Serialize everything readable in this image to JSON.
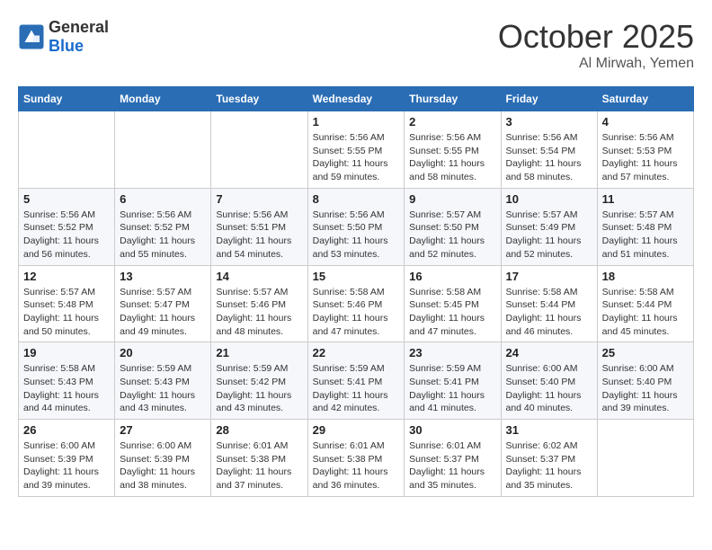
{
  "header": {
    "logo_general": "General",
    "logo_blue": "Blue",
    "month": "October 2025",
    "location": "Al Mirwah, Yemen"
  },
  "days_of_week": [
    "Sunday",
    "Monday",
    "Tuesday",
    "Wednesday",
    "Thursday",
    "Friday",
    "Saturday"
  ],
  "weeks": [
    [
      {
        "day": "",
        "sunrise": "",
        "sunset": "",
        "daylight": ""
      },
      {
        "day": "",
        "sunrise": "",
        "sunset": "",
        "daylight": ""
      },
      {
        "day": "",
        "sunrise": "",
        "sunset": "",
        "daylight": ""
      },
      {
        "day": "1",
        "sunrise": "Sunrise: 5:56 AM",
        "sunset": "Sunset: 5:55 PM",
        "daylight": "Daylight: 11 hours and 59 minutes."
      },
      {
        "day": "2",
        "sunrise": "Sunrise: 5:56 AM",
        "sunset": "Sunset: 5:55 PM",
        "daylight": "Daylight: 11 hours and 58 minutes."
      },
      {
        "day": "3",
        "sunrise": "Sunrise: 5:56 AM",
        "sunset": "Sunset: 5:54 PM",
        "daylight": "Daylight: 11 hours and 58 minutes."
      },
      {
        "day": "4",
        "sunrise": "Sunrise: 5:56 AM",
        "sunset": "Sunset: 5:53 PM",
        "daylight": "Daylight: 11 hours and 57 minutes."
      }
    ],
    [
      {
        "day": "5",
        "sunrise": "Sunrise: 5:56 AM",
        "sunset": "Sunset: 5:52 PM",
        "daylight": "Daylight: 11 hours and 56 minutes."
      },
      {
        "day": "6",
        "sunrise": "Sunrise: 5:56 AM",
        "sunset": "Sunset: 5:52 PM",
        "daylight": "Daylight: 11 hours and 55 minutes."
      },
      {
        "day": "7",
        "sunrise": "Sunrise: 5:56 AM",
        "sunset": "Sunset: 5:51 PM",
        "daylight": "Daylight: 11 hours and 54 minutes."
      },
      {
        "day": "8",
        "sunrise": "Sunrise: 5:56 AM",
        "sunset": "Sunset: 5:50 PM",
        "daylight": "Daylight: 11 hours and 53 minutes."
      },
      {
        "day": "9",
        "sunrise": "Sunrise: 5:57 AM",
        "sunset": "Sunset: 5:50 PM",
        "daylight": "Daylight: 11 hours and 52 minutes."
      },
      {
        "day": "10",
        "sunrise": "Sunrise: 5:57 AM",
        "sunset": "Sunset: 5:49 PM",
        "daylight": "Daylight: 11 hours and 52 minutes."
      },
      {
        "day": "11",
        "sunrise": "Sunrise: 5:57 AM",
        "sunset": "Sunset: 5:48 PM",
        "daylight": "Daylight: 11 hours and 51 minutes."
      }
    ],
    [
      {
        "day": "12",
        "sunrise": "Sunrise: 5:57 AM",
        "sunset": "Sunset: 5:48 PM",
        "daylight": "Daylight: 11 hours and 50 minutes."
      },
      {
        "day": "13",
        "sunrise": "Sunrise: 5:57 AM",
        "sunset": "Sunset: 5:47 PM",
        "daylight": "Daylight: 11 hours and 49 minutes."
      },
      {
        "day": "14",
        "sunrise": "Sunrise: 5:57 AM",
        "sunset": "Sunset: 5:46 PM",
        "daylight": "Daylight: 11 hours and 48 minutes."
      },
      {
        "day": "15",
        "sunrise": "Sunrise: 5:58 AM",
        "sunset": "Sunset: 5:46 PM",
        "daylight": "Daylight: 11 hours and 47 minutes."
      },
      {
        "day": "16",
        "sunrise": "Sunrise: 5:58 AM",
        "sunset": "Sunset: 5:45 PM",
        "daylight": "Daylight: 11 hours and 47 minutes."
      },
      {
        "day": "17",
        "sunrise": "Sunrise: 5:58 AM",
        "sunset": "Sunset: 5:44 PM",
        "daylight": "Daylight: 11 hours and 46 minutes."
      },
      {
        "day": "18",
        "sunrise": "Sunrise: 5:58 AM",
        "sunset": "Sunset: 5:44 PM",
        "daylight": "Daylight: 11 hours and 45 minutes."
      }
    ],
    [
      {
        "day": "19",
        "sunrise": "Sunrise: 5:58 AM",
        "sunset": "Sunset: 5:43 PM",
        "daylight": "Daylight: 11 hours and 44 minutes."
      },
      {
        "day": "20",
        "sunrise": "Sunrise: 5:59 AM",
        "sunset": "Sunset: 5:43 PM",
        "daylight": "Daylight: 11 hours and 43 minutes."
      },
      {
        "day": "21",
        "sunrise": "Sunrise: 5:59 AM",
        "sunset": "Sunset: 5:42 PM",
        "daylight": "Daylight: 11 hours and 43 minutes."
      },
      {
        "day": "22",
        "sunrise": "Sunrise: 5:59 AM",
        "sunset": "Sunset: 5:41 PM",
        "daylight": "Daylight: 11 hours and 42 minutes."
      },
      {
        "day": "23",
        "sunrise": "Sunrise: 5:59 AM",
        "sunset": "Sunset: 5:41 PM",
        "daylight": "Daylight: 11 hours and 41 minutes."
      },
      {
        "day": "24",
        "sunrise": "Sunrise: 6:00 AM",
        "sunset": "Sunset: 5:40 PM",
        "daylight": "Daylight: 11 hours and 40 minutes."
      },
      {
        "day": "25",
        "sunrise": "Sunrise: 6:00 AM",
        "sunset": "Sunset: 5:40 PM",
        "daylight": "Daylight: 11 hours and 39 minutes."
      }
    ],
    [
      {
        "day": "26",
        "sunrise": "Sunrise: 6:00 AM",
        "sunset": "Sunset: 5:39 PM",
        "daylight": "Daylight: 11 hours and 39 minutes."
      },
      {
        "day": "27",
        "sunrise": "Sunrise: 6:00 AM",
        "sunset": "Sunset: 5:39 PM",
        "daylight": "Daylight: 11 hours and 38 minutes."
      },
      {
        "day": "28",
        "sunrise": "Sunrise: 6:01 AM",
        "sunset": "Sunset: 5:38 PM",
        "daylight": "Daylight: 11 hours and 37 minutes."
      },
      {
        "day": "29",
        "sunrise": "Sunrise: 6:01 AM",
        "sunset": "Sunset: 5:38 PM",
        "daylight": "Daylight: 11 hours and 36 minutes."
      },
      {
        "day": "30",
        "sunrise": "Sunrise: 6:01 AM",
        "sunset": "Sunset: 5:37 PM",
        "daylight": "Daylight: 11 hours and 35 minutes."
      },
      {
        "day": "31",
        "sunrise": "Sunrise: 6:02 AM",
        "sunset": "Sunset: 5:37 PM",
        "daylight": "Daylight: 11 hours and 35 minutes."
      },
      {
        "day": "",
        "sunrise": "",
        "sunset": "",
        "daylight": ""
      }
    ]
  ]
}
